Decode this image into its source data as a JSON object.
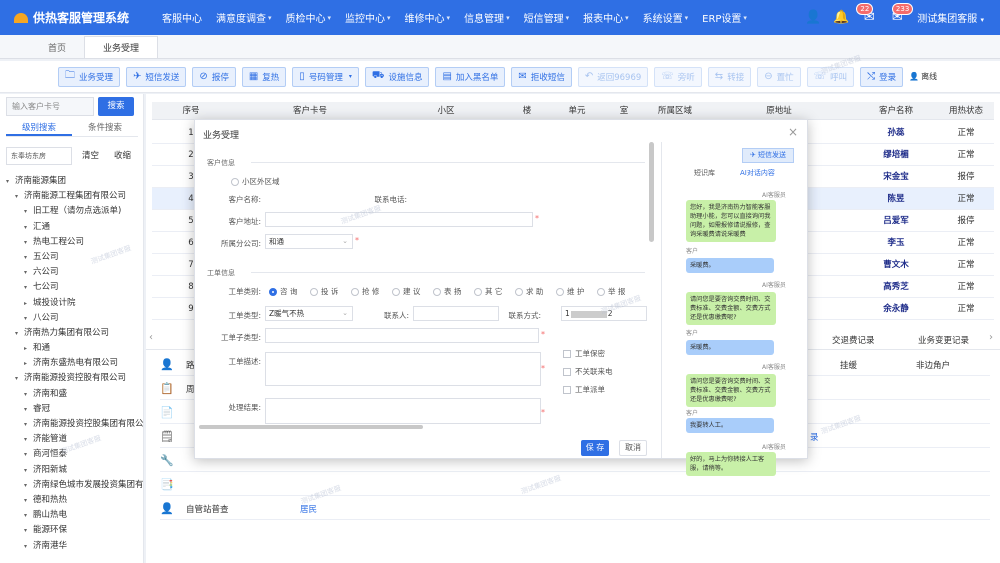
{
  "app": {
    "title": "供热客服管理系统"
  },
  "nav": {
    "items": [
      "客服中心",
      "满意度调查",
      "质检中心",
      "监控中心",
      "维修中心",
      "信息管理",
      "短信管理",
      "报表中心",
      "系统设置",
      "ERP设置"
    ],
    "badge_msg": "22",
    "badge_bell": "233",
    "user": "测试集团客服"
  },
  "tabs": [
    "首页",
    "业务受理"
  ],
  "toolbar": {
    "buttons": [
      {
        "label": "业务受理",
        "icon": "🗀",
        "dis": false
      },
      {
        "label": "短信发送",
        "icon": "✈",
        "dis": false
      },
      {
        "label": "报停",
        "icon": "⊘",
        "dis": false
      },
      {
        "label": "复热",
        "icon": "▦",
        "dis": false
      },
      {
        "label": "号码管理",
        "icon": "▯",
        "dis": false,
        "dd": true
      },
      {
        "label": "设施信息",
        "icon": "⛟",
        "dis": false
      },
      {
        "label": "加入黑名单",
        "icon": "▤",
        "dis": false
      },
      {
        "label": "拒收短信",
        "icon": "✉",
        "dis": false
      },
      {
        "label": "返回96969",
        "icon": "↶",
        "dis": true
      },
      {
        "label": "旁听",
        "icon": "☏",
        "dis": true
      },
      {
        "label": "转接",
        "icon": "⇆",
        "dis": true
      },
      {
        "label": "置忙",
        "icon": "⊖",
        "dis": true
      },
      {
        "label": "呼叫",
        "icon": "☏",
        "dis": true
      },
      {
        "label": "登录",
        "icon": "⤭",
        "dis": false
      }
    ],
    "last": "离线"
  },
  "left": {
    "search_placeholder": "输入客户卡号",
    "search_btn": "搜索",
    "tabs": [
      "级别搜索",
      "条件搜索"
    ],
    "filter": "东奉坊东房",
    "clear": "清空",
    "collapse": "收缩",
    "tree": [
      {
        "t": "济南能源集团",
        "l": 0,
        "a": "▾"
      },
      {
        "t": "济南能源工程集团有限公司",
        "l": 1,
        "a": "▾"
      },
      {
        "t": "旧工程（请勿点选派单)",
        "l": 2,
        "a": "▾"
      },
      {
        "t": "汇通",
        "l": 2,
        "a": "▾"
      },
      {
        "t": "热电工程公司",
        "l": 2,
        "a": "▾"
      },
      {
        "t": "五公司",
        "l": 2,
        "a": "▾"
      },
      {
        "t": "六公司",
        "l": 2,
        "a": "▾"
      },
      {
        "t": "七公司",
        "l": 2,
        "a": "▾"
      },
      {
        "t": "城投设计院",
        "l": 2,
        "a": "▸"
      },
      {
        "t": "八公司",
        "l": 2,
        "a": "▾"
      },
      {
        "t": "济南热力集团有限公司",
        "l": 1,
        "a": "▾"
      },
      {
        "t": "和通",
        "l": 2,
        "a": "▸"
      },
      {
        "t": "济南东盛热电有限公司",
        "l": 2,
        "a": "▸"
      },
      {
        "t": "济南能源投资控股有限公司",
        "l": 1,
        "a": "▾"
      },
      {
        "t": "济南和盛",
        "l": 2,
        "a": "▾"
      },
      {
        "t": "睿冠",
        "l": 2,
        "a": "▾"
      },
      {
        "t": "济南能源投资控股集团有限公",
        "l": 2,
        "a": "▾"
      },
      {
        "t": "济能管道",
        "l": 2,
        "a": "▾"
      },
      {
        "t": "商河恒泰",
        "l": 2,
        "a": "▾"
      },
      {
        "t": "济阳新城",
        "l": 2,
        "a": "▾"
      },
      {
        "t": "济南绿色城市发展投资集团有",
        "l": 2,
        "a": "▾"
      },
      {
        "t": "德和热热",
        "l": 2,
        "a": "▾"
      },
      {
        "t": "鹏山热电",
        "l": 2,
        "a": "▾"
      },
      {
        "t": "能源环保",
        "l": 2,
        "a": "▾"
      },
      {
        "t": "济南港华",
        "l": 2,
        "a": "▾"
      }
    ]
  },
  "table": {
    "headers": [
      "序号",
      "客户卡号",
      "小区",
      "楼",
      "单元",
      "室",
      "所属区域",
      "原地址",
      "客户名称",
      "用热状态"
    ],
    "rows": [
      [
        "1",
        "孙蕊",
        "正常"
      ],
      [
        "2",
        "缪培楣",
        "正常"
      ],
      [
        "3",
        "宋金宝",
        "报停"
      ],
      [
        "4",
        "陈昱",
        "正常"
      ],
      [
        "5",
        "吕爱军",
        "报停"
      ],
      [
        "6",
        "李玉",
        "正常"
      ],
      [
        "7",
        "曹文木",
        "正常"
      ],
      [
        "8",
        "高秀芝",
        "正常"
      ],
      [
        "9",
        "余永静",
        "正常"
      ]
    ]
  },
  "sub": {
    "tabs": [
      "交退费记录",
      "业务变更记录"
    ],
    "rows": [
      {
        "a": "",
        "b": "挂缓",
        "c": "非边角户"
      },
      {
        "a": "",
        "b": "",
        "c": ""
      },
      {
        "a": "",
        "b": "",
        "c": ""
      },
      {
        "a": "",
        "b": "",
        "c": ""
      },
      {
        "a": "",
        "b": "",
        "c": ""
      },
      {
        "a": "",
        "b": "",
        "c": ""
      },
      {
        "a": "自管站普查",
        "b": "居民",
        "c": ""
      }
    ],
    "first_label": "路",
    "second_label": "周",
    "link_text": "录"
  },
  "dialog": {
    "title": "业务受理",
    "sec_customer": "客户信息",
    "radio_outside": "小区外区域",
    "l_name": "客户名称:",
    "l_phone": "联系电话:",
    "l_addr": "客户地址:",
    "l_company": "所属分公司:",
    "v_company": "和通",
    "sec_order": "工单信息",
    "l_type": "工单类别:",
    "types": [
      "咨 询",
      "投 诉",
      "抢 修",
      "建 议",
      "表 扬",
      "其 它",
      "求 助",
      "维 护",
      "举 报"
    ],
    "l_subtype": "工单类型:",
    "v_subtype": "Z暖气不热",
    "l_contact": "联系人:",
    "l_method": "联系方式:",
    "v_method": "1",
    "v_method_end": "2",
    "l_subcat": "工单子类型:",
    "l_desc": "工单描述:",
    "l_result": "处理结果:",
    "chk": [
      "工单保密",
      "不关联来电",
      "工单派单"
    ],
    "save": "保 存",
    "cancel": "取消"
  },
  "chat": {
    "sms": "短信发送",
    "tabs": [
      "短识库",
      "AI对话内容"
    ],
    "ai": "AI客服员",
    "cust": "客户",
    "msgs": [
      {
        "w": "ai",
        "t": "您好，我是济南热力智能客服助理小能，您可以直接询问我问题，如需报修请说报修，查询采暖费请说采暖费"
      },
      {
        "w": "cu",
        "t": "采暖费。"
      },
      {
        "w": "ai",
        "t": "请问您是要咨询交费时间、交费标准、交费金额、交费方式还是优惠缴费呢?"
      },
      {
        "w": "cu",
        "t": "采暖费。"
      },
      {
        "w": "ai",
        "t": "请问您是要咨询交费时间、交费标准、交费金额、交费方式还是优惠缴费呢?"
      },
      {
        "w": "cu",
        "t": "我要转人工。"
      },
      {
        "w": "ai",
        "t": "好的，马上为你转接人工客服，请稍等。"
      }
    ]
  },
  "watermark": "测试集团客服"
}
